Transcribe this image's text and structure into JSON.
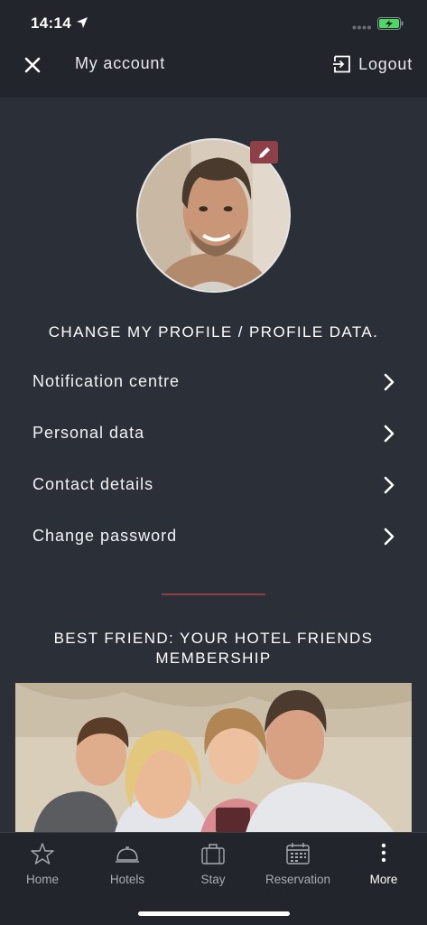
{
  "status_bar": {
    "time": "14:14"
  },
  "header": {
    "title": "My account",
    "logout_label": "Logout"
  },
  "profile": {
    "heading": "CHANGE MY PROFILE / PROFILE DATA."
  },
  "menu": {
    "items": [
      {
        "label": "Notification centre",
        "icon": "chevron-right-icon"
      },
      {
        "label": "Personal data",
        "icon": "chevron-right-icon"
      },
      {
        "label": "Contact details",
        "icon": "chevron-right-icon"
      },
      {
        "label": "Change password",
        "icon": "chevron-right-icon"
      }
    ]
  },
  "best_friend": {
    "heading_line1": "BEST FRIEND: YOUR HOTEL FRIENDS",
    "heading_line2": "MEMBERSHIP"
  },
  "tabs": [
    {
      "label": "Home",
      "icon": "star-icon"
    },
    {
      "label": "Hotels",
      "icon": "bell-icon"
    },
    {
      "label": "Stay",
      "icon": "suitcase-icon"
    },
    {
      "label": "Reservation",
      "icon": "calendar-icon"
    },
    {
      "label": "More",
      "icon": "more-vertical-icon",
      "active": true
    }
  ],
  "colors": {
    "background": "#2b2f38",
    "header_background": "#22252b",
    "accent": "#8e3f47",
    "battery_green": "#4cd964"
  }
}
